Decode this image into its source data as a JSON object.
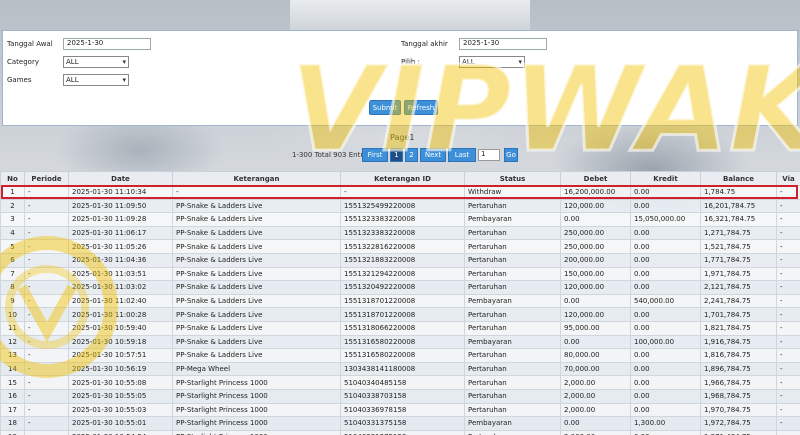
{
  "filters": {
    "start_label": "Tanggal Awal",
    "start_value": "2025-1-30",
    "end_label": "Tanggal akhir",
    "end_value": "2025-1-30",
    "category_label": "Category",
    "category_value": "ALL",
    "pilih_label": "Pilih  :",
    "pilih_value": "ALL",
    "games_label": "Games",
    "games_value": "ALL",
    "submit_label": "Submit",
    "refresh_label": "Refresh"
  },
  "pager": {
    "title": "Page1",
    "info": "1-300 Total 903 Entri",
    "first": "First",
    "page1": "1",
    "page2": "2",
    "next": "Next",
    "last": "Last",
    "input_value": "1",
    "go": "Go"
  },
  "table": {
    "headers": [
      "No",
      "Periode",
      "Date",
      "Keterangan",
      "Keterangan ID",
      "Status",
      "Debet",
      "Kredit",
      "Balance",
      "Via"
    ],
    "rows": [
      [
        "1",
        "-",
        "2025-01-30 11:10:34",
        "-",
        "-",
        "Withdraw",
        "16,200,000.00",
        "0.00",
        "1,784.75",
        "-"
      ],
      [
        "2",
        "-",
        "2025-01-30 11:09:50",
        "PP-Snake & Ladders Live",
        "1551325499220008",
        "Pertaruhan",
        "120,000.00",
        "0.00",
        "16,201,784.75",
        "-"
      ],
      [
        "3",
        "-",
        "2025-01-30 11:09:28",
        "PP-Snake & Ladders Live",
        "1551323383220008",
        "Pembayaran",
        "0.00",
        "15,050,000.00",
        "16,321,784.75",
        "-"
      ],
      [
        "4",
        "-",
        "2025-01-30 11:06:17",
        "PP-Snake & Ladders Live",
        "1551323383220008",
        "Pertaruhan",
        "250,000.00",
        "0.00",
        "1,271,784.75",
        "-"
      ],
      [
        "5",
        "-",
        "2025-01-30 11:05:26",
        "PP-Snake & Ladders Live",
        "1551322816220008",
        "Pertaruhan",
        "250,000.00",
        "0.00",
        "1,521,784.75",
        "-"
      ],
      [
        "6",
        "-",
        "2025-01-30 11:04:36",
        "PP-Snake & Ladders Live",
        "1551321883220008",
        "Pertaruhan",
        "200,000.00",
        "0.00",
        "1,771,784.75",
        "-"
      ],
      [
        "7",
        "-",
        "2025-01-30 11:03:51",
        "PP-Snake & Ladders Live",
        "1551321294220008",
        "Pertaruhan",
        "150,000.00",
        "0.00",
        "1,971,784.75",
        "-"
      ],
      [
        "8",
        "-",
        "2025-01-30 11:03:02",
        "PP-Snake & Ladders Live",
        "1551320492220008",
        "Pertaruhan",
        "120,000.00",
        "0.00",
        "2,121,784.75",
        "-"
      ],
      [
        "9",
        "-",
        "2025-01-30 11:02:40",
        "PP-Snake & Ladders Live",
        "1551318701220008",
        "Pembayaran",
        "0.00",
        "540,000.00",
        "2,241,784.75",
        "-"
      ],
      [
        "10",
        "-",
        "2025-01-30 11:00:28",
        "PP-Snake & Ladders Live",
        "1551318701220008",
        "Pertaruhan",
        "120,000.00",
        "0.00",
        "1,701,784.75",
        "-"
      ],
      [
        "11",
        "-",
        "2025-01-30 10:59:40",
        "PP-Snake & Ladders Live",
        "1551318066220008",
        "Pertaruhan",
        "95,000.00",
        "0.00",
        "1,821,784.75",
        "-"
      ],
      [
        "12",
        "-",
        "2025-01-30 10:59:18",
        "PP-Snake & Ladders Live",
        "1551316580220008",
        "Pembayaran",
        "0.00",
        "100,000.00",
        "1,916,784.75",
        "-"
      ],
      [
        "13",
        "-",
        "2025-01-30 10:57:51",
        "PP-Snake & Ladders Live",
        "1551316580220008",
        "Pertaruhan",
        "80,000.00",
        "0.00",
        "1,816,784.75",
        "-"
      ],
      [
        "14",
        "-",
        "2025-01-30 10:56:19",
        "PP-Mega Wheel",
        "1303438141180008",
        "Pertaruhan",
        "70,000.00",
        "0.00",
        "1,896,784.75",
        "-"
      ],
      [
        "15",
        "-",
        "2025-01-30 10:55:08",
        "PP-Starlight Princess 1000",
        "51040340485158",
        "Pertaruhan",
        "2,000.00",
        "0.00",
        "1,966,784.75",
        "-"
      ],
      [
        "16",
        "-",
        "2025-01-30 10:55:05",
        "PP-Starlight Princess 1000",
        "51040338703158",
        "Pertaruhan",
        "2,000.00",
        "0.00",
        "1,968,784.75",
        "-"
      ],
      [
        "17",
        "-",
        "2025-01-30 10:55:03",
        "PP-Starlight Princess 1000",
        "51040336978158",
        "Pertaruhan",
        "2,000.00",
        "0.00",
        "1,970,784.75",
        "-"
      ],
      [
        "18",
        "-",
        "2025-01-30 10:55:01",
        "PP-Starlight Princess 1000",
        "51040331375158",
        "Pembayaran",
        "0.00",
        "1,300.00",
        "1,972,784.75",
        "-"
      ],
      [
        "19",
        "-",
        "2025-01-30 10:54:54",
        "PP-Starlight Princess 1000",
        "51040331375158",
        "Pertaruhan",
        "2,000.00",
        "0.00",
        "1,971,484.75",
        "-"
      ]
    ]
  },
  "watermark": {
    "text": "VIPWAK"
  },
  "colors": {
    "accent": "#3d8fd8",
    "highlight_border": "#d2202a",
    "id_link": "#2a7ed0",
    "watermark": "#f2c200"
  }
}
